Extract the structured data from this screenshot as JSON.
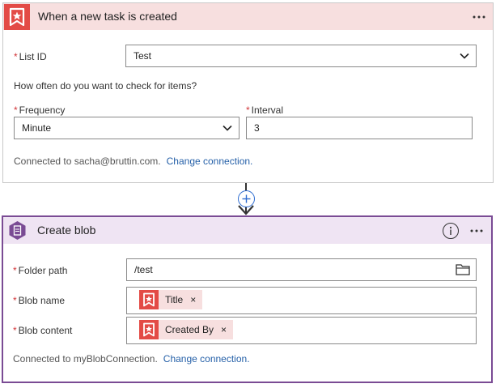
{
  "trigger": {
    "title": "When a new task is created",
    "icon": "wunderlist-star-icon",
    "accent": "#e34b46",
    "header_bg": "#f7dfdf",
    "more_label": "···",
    "list_id": {
      "label": "List ID",
      "value": "Test"
    },
    "question": "How often do you want to check for items?",
    "frequency": {
      "label": "Frequency",
      "value": "Minute"
    },
    "interval": {
      "label": "Interval",
      "value": "3"
    },
    "connected_text": "Connected to sacha@bruttin.com.",
    "change_connection": "Change connection."
  },
  "connector": {
    "icon": "plus-icon"
  },
  "action": {
    "title": "Create blob",
    "icon": "blob-storage-icon",
    "accent": "#7a4b94",
    "header_bg": "#efe4f3",
    "more_label": "···",
    "info_label": "i",
    "folder_path": {
      "label": "Folder path",
      "value": "/test"
    },
    "blob_name": {
      "label": "Blob name",
      "token": "Title",
      "token_close": "×"
    },
    "blob_content": {
      "label": "Blob content",
      "token": "Created By",
      "token_close": "×"
    },
    "connected_text": "Connected to myBlobConnection.",
    "change_connection": "Change connection."
  },
  "required_marker": "*"
}
